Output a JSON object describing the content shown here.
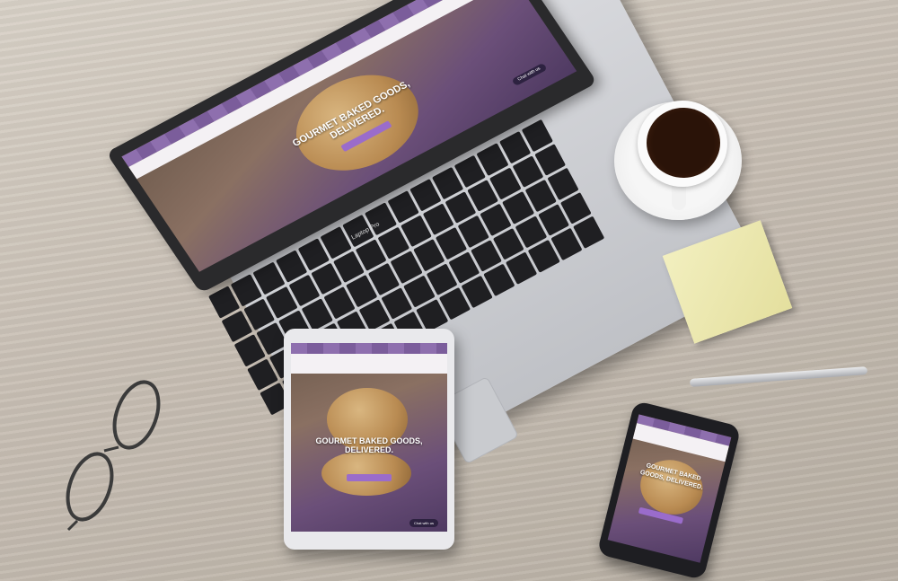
{
  "site": {
    "hero_title": "GOURMET BAKED GOODS, DELIVERED.",
    "hero_title_phone_line1": "GOURMET BAKED",
    "hero_title_phone_line2": "GOODS, DELIVERED.",
    "chat_button": "Chat with us"
  },
  "laptop": {
    "brand_label": "Laptop Pro"
  },
  "colors": {
    "brand_purple": "#8e6fae",
    "button_purple": "#9a6ccb",
    "coffee": "#2a1308",
    "sticky_note": "#ebe6ad"
  }
}
